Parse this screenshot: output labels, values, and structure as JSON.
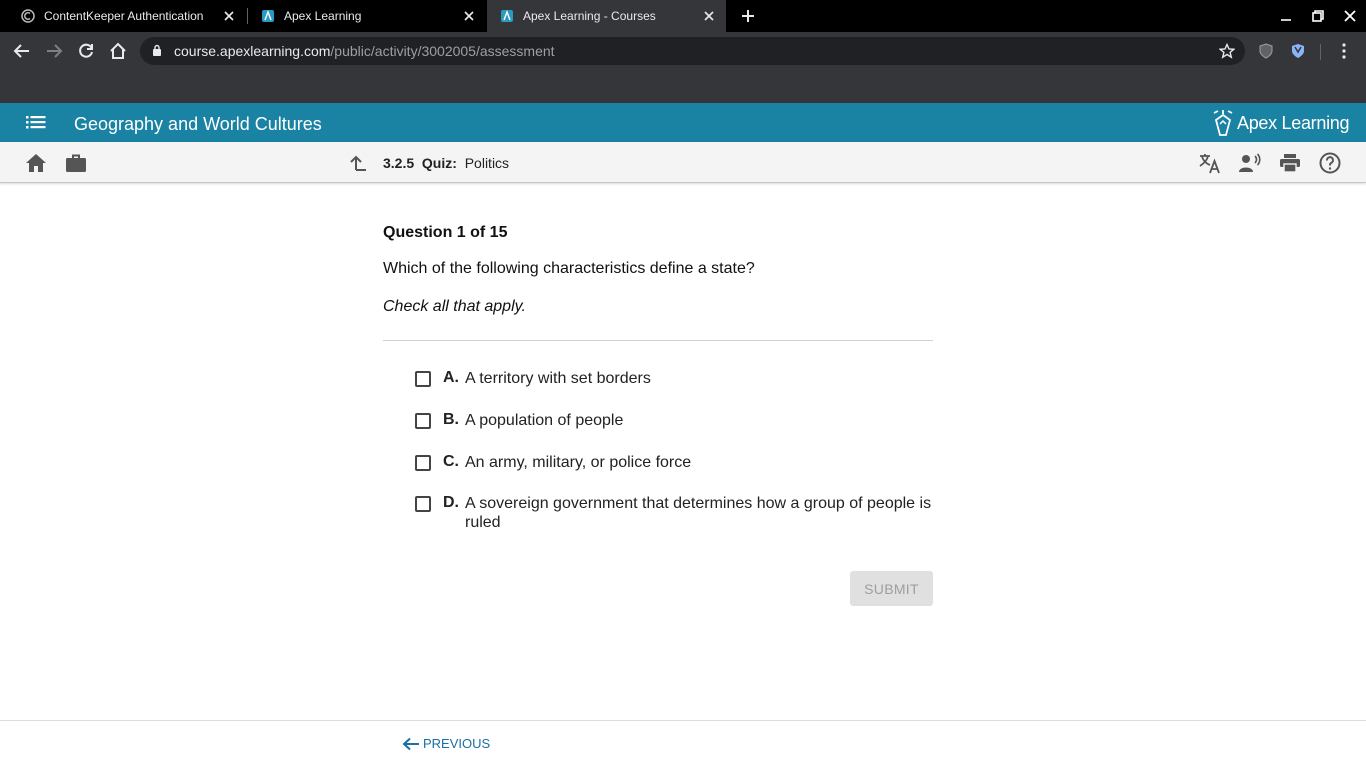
{
  "browser": {
    "tabs": [
      {
        "title": "ContentKeeper Authentication",
        "active": false
      },
      {
        "title": "Apex Learning",
        "active": false
      },
      {
        "title": "Apex Learning - Courses",
        "active": true
      }
    ],
    "url_host": "course.apexlearning.com",
    "url_path": "/public/activity/3002005/assessment"
  },
  "app": {
    "course_title": "Geography and World Cultures",
    "brand": "Apex Learning"
  },
  "breadcrumb": {
    "number": "3.2.5",
    "type": "Quiz:",
    "name": "Politics"
  },
  "question": {
    "header": "Question 1 of 15",
    "text": "Which of the following characteristics define a state?",
    "hint": "Check all that apply.",
    "options": [
      {
        "letter": "A.",
        "text": "A territory with set borders",
        "checked": false
      },
      {
        "letter": "B.",
        "text": "A population of people",
        "checked": false
      },
      {
        "letter": "C.",
        "text": "An army, military, or police force",
        "checked": false
      },
      {
        "letter": "D.",
        "text": "A sovereign government that determines how a group of people is ruled",
        "checked": false
      }
    ],
    "submit_label": "SUBMIT"
  },
  "footer": {
    "previous_label": "PREVIOUS"
  },
  "colors": {
    "app_bar": "#1a82a3",
    "link": "#1a6fa3"
  }
}
